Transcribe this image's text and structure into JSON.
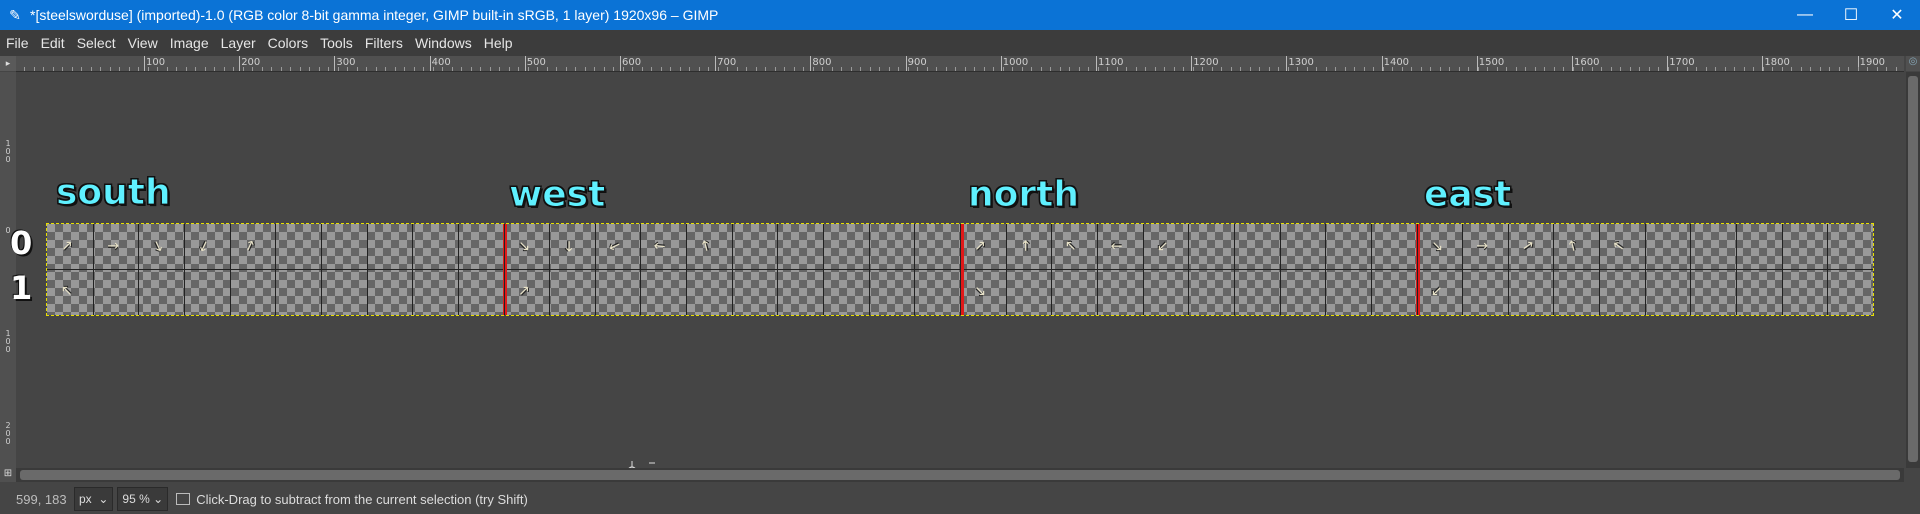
{
  "window": {
    "title": "*[steelsworduse] (imported)-1.0 (RGB color 8-bit gamma integer, GIMP built-in sRGB, 1 layer) 1920x96 – GIMP",
    "minimize": "—",
    "maximize": "☐",
    "close": "✕"
  },
  "menu": [
    "File",
    "Edit",
    "Select",
    "View",
    "Image",
    "Layer",
    "Colors",
    "Tools",
    "Filters",
    "Windows",
    "Help"
  ],
  "ruler": {
    "h_labels": [
      "100",
      "200",
      "300",
      "400",
      "500",
      "600",
      "700",
      "800",
      "900",
      "1000",
      "1100",
      "1200",
      "1300",
      "1400",
      "1500",
      "1600",
      "1700",
      "1800",
      "1900"
    ],
    "v_labels": [
      "1\n0\n0",
      "0",
      "1\n0\n0",
      "2\n0\n0"
    ]
  },
  "canvas": {
    "directions": [
      "south",
      "west",
      "north",
      "east"
    ],
    "rows": [
      "0",
      "1"
    ],
    "sprite_glyph": "↗"
  },
  "status": {
    "coords": "599, 183",
    "unit": "px",
    "zoom": "95 %",
    "message": "Click-Drag to subtract from the current selection (try Shift)"
  }
}
